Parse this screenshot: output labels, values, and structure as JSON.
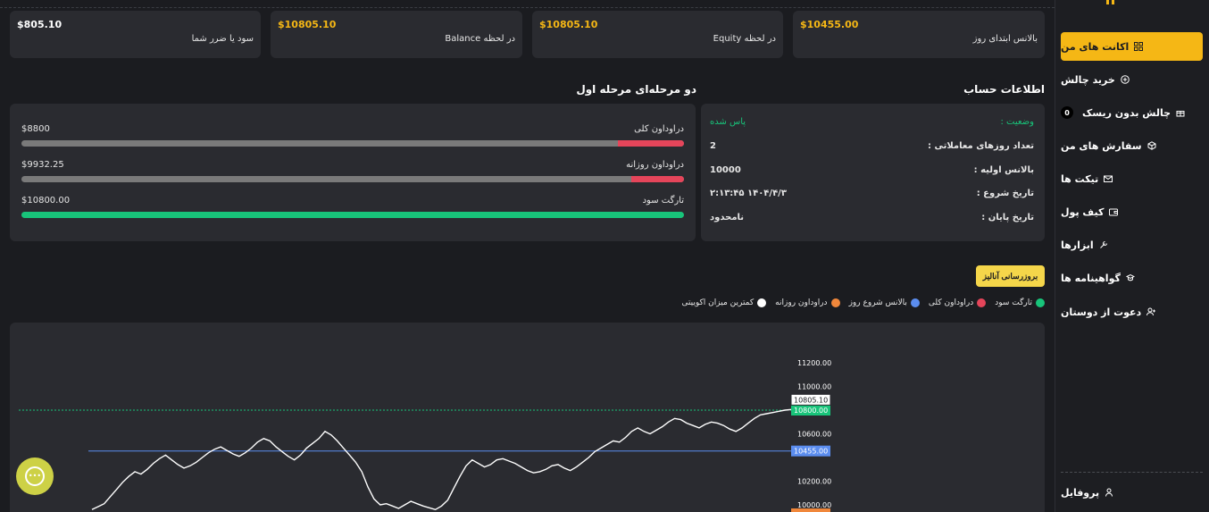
{
  "stats": [
    {
      "value": "$805.10",
      "label": "سود یا ضرر شما",
      "color": "#ffffff"
    },
    {
      "value": "$10805.10",
      "label": "در لحظه Balance",
      "color": "#f5b715"
    },
    {
      "value": "$10805.10",
      "label": "در لحظه Equity",
      "color": "#f5b715"
    },
    {
      "value": "$10455.00",
      "label": "بالانس ابتدای روز",
      "color": "#f5b715"
    }
  ],
  "account_info": {
    "title": "اطلاعات حساب",
    "status_label": "وضعیت :",
    "status_value": "پاس شده",
    "rows": [
      {
        "key": "تعداد روزهای معاملاتی :",
        "value": "2"
      },
      {
        "key": "بالانس اولیه :",
        "value": "10000"
      },
      {
        "key": "تاریخ شروع :",
        "value": "۲:۱۳:۴۵ ۱۴۰۴/۴/۳"
      },
      {
        "key": "تاریخ پایان :",
        "value": "نامحدود"
      }
    ]
  },
  "challenge": {
    "title": "دو مرحله‌ای مرحله اول",
    "bars": [
      {
        "label": "دراوداون کلی",
        "value": "$8800",
        "fill_fraction": 0.1
      },
      {
        "label": "دراوداون روزانه",
        "value": "$9932.25",
        "fill_fraction": 0.08
      },
      {
        "label": "تارگت سود",
        "value": "$10800.00",
        "fill_fraction": 1.0
      }
    ]
  },
  "update_button": "بروزرسانی آنالیز",
  "legend": [
    {
      "label": "کمترین میزان اکوییتی",
      "color": "#ffffff"
    },
    {
      "label": "دراوداون روزانه",
      "color": "#f0873b"
    },
    {
      "label": "بالانس شروع روز",
      "color": "#5b8def"
    },
    {
      "label": "دراوداون کلی",
      "color": "#e5455a"
    },
    {
      "label": "تارگت سود",
      "color": "#18c47a"
    }
  ],
  "sidebar": {
    "items": [
      {
        "label": "اکانت های من",
        "icon": "grid-icon",
        "active": true
      },
      {
        "label": "خرید چالش",
        "icon": "plus-circle-icon"
      },
      {
        "label": "چالش بدون ریسک",
        "icon": "gift-icon",
        "badge": "0"
      },
      {
        "label": "سفارش های من",
        "icon": "box-icon"
      },
      {
        "label": "تیکت ها",
        "icon": "mail-icon"
      },
      {
        "label": "کیف پول",
        "icon": "wallet-icon"
      },
      {
        "label": "ابزارها",
        "icon": "tools-icon"
      },
      {
        "label": "گواهینامه ها",
        "icon": "certificate-icon"
      },
      {
        "label": "دعوت از دوستان",
        "icon": "user-plus-icon"
      }
    ],
    "profile": {
      "label": "پروفایل",
      "icon": "user-icon"
    }
  },
  "chart_data": {
    "type": "line",
    "y_ticks": [
      "11200.00",
      "11000.00",
      "10600.00",
      "10200.00",
      "10000.00"
    ],
    "reference_lines": [
      {
        "name": "تارگت سود",
        "value": 10800.0,
        "label": "10800.00",
        "color": "#18c47a"
      },
      {
        "name": "بالانس شروع روز",
        "value": 10455.0,
        "label": "10455.00",
        "color": "#5b8def"
      }
    ],
    "current_value_label": "10805.10",
    "current_value": 10805.1,
    "ylim": [
      9960,
      11300
    ],
    "series": [
      {
        "values": [
          9960,
          9985,
          10010,
          10070,
          10130,
          10190,
          10240,
          10280,
          10260,
          10300,
          10350,
          10390,
          10420,
          10380,
          10340,
          10310,
          10330,
          10360,
          10400,
          10440,
          10470,
          10490,
          10460,
          10430,
          10410,
          10440,
          10480,
          10530,
          10560,
          10540,
          10490,
          10450,
          10410,
          10380,
          10420,
          10480,
          10520,
          10560,
          10620,
          10590,
          10540,
          10480,
          10420,
          10360,
          10280,
          10150,
          10050,
          10000,
          10010,
          9990,
          9970,
          10000,
          10030,
          10010,
          9990,
          9975,
          9960,
          9990,
          10040,
          10140,
          10240,
          10330,
          10380,
          10350,
          10320,
          10340,
          10380,
          10390,
          10370,
          10350,
          10320,
          10290,
          10270,
          10280,
          10300,
          10330,
          10340,
          10310,
          10290,
          10320,
          10360,
          10400,
          10450,
          10480,
          10510,
          10540,
          10530,
          10570,
          10620,
          10650,
          10620,
          10600,
          10630,
          10660,
          10700,
          10730,
          10720,
          10690,
          10670,
          10650,
          10680,
          10700,
          10690,
          10670,
          10640,
          10620,
          10650,
          10690,
          10730,
          10760,
          10770,
          10780,
          10790,
          10800,
          10805
        ]
      }
    ]
  },
  "colors": {
    "accent": "#f5b715",
    "card": "#2a2b30",
    "background": "#1b1c20",
    "success": "#18c47a",
    "danger": "#e5455a"
  }
}
